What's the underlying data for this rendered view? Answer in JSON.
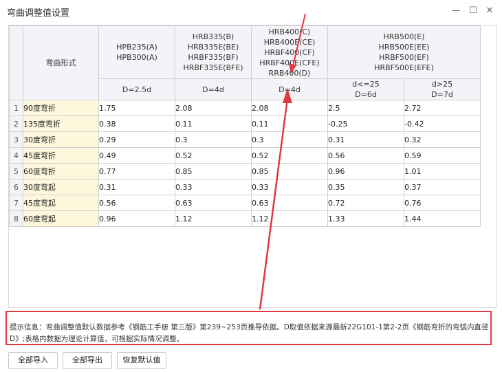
{
  "window": {
    "title": "弯曲调整值设置",
    "minimize_glyph": "—",
    "maximize_glyph": "☐",
    "close_glyph": "✕"
  },
  "table": {
    "label_header": "弯曲形式",
    "groups": [
      {
        "lines": [
          "HPB235(A)",
          "HPB300(A)"
        ]
      },
      {
        "lines": [
          "HRB335(B)",
          "HRB335E(BE)",
          "HRBF335(BF)",
          "HRBF335E(BFE)"
        ]
      },
      {
        "lines": [
          "HRB400(C)",
          "HRB400E(CE)",
          "HRBF400(CF)",
          "HRBF400E(CFE)",
          "RRB400(D)"
        ]
      },
      {
        "lines": [
          "HRB500(E)",
          "HRB500E(EE)",
          "HRBF500(EF)",
          "HRBF500E(EFE)"
        ]
      }
    ],
    "subheaders": [
      {
        "lines": [
          "D=2.5d"
        ]
      },
      {
        "lines": [
          "D=4d"
        ]
      },
      {
        "lines": [
          "D=4d"
        ]
      },
      {
        "lines": [
          "d<=25",
          "D=6d"
        ]
      },
      {
        "lines": [
          "d>25",
          "D=7d"
        ]
      }
    ],
    "rows": [
      {
        "num": "1",
        "label": "90度弯折",
        "values": [
          "1.75",
          "2.08",
          "2.08",
          "2.5",
          "2.72"
        ]
      },
      {
        "num": "2",
        "label": "135度弯折",
        "values": [
          "0.38",
          "0.11",
          "0.11",
          "-0.25",
          "-0.42"
        ]
      },
      {
        "num": "3",
        "label": "30度弯折",
        "values": [
          "0.29",
          "0.3",
          "0.3",
          "0.31",
          "0.32"
        ]
      },
      {
        "num": "4",
        "label": "45度弯折",
        "values": [
          "0.49",
          "0.52",
          "0.52",
          "0.56",
          "0.59"
        ]
      },
      {
        "num": "5",
        "label": "60度弯折",
        "values": [
          "0.77",
          "0.85",
          "0.85",
          "0.96",
          "1.01"
        ]
      },
      {
        "num": "6",
        "label": "30度弯起",
        "values": [
          "0.31",
          "0.33",
          "0.33",
          "0.35",
          "0.37"
        ]
      },
      {
        "num": "7",
        "label": "45度弯起",
        "values": [
          "0.56",
          "0.63",
          "0.63",
          "0.72",
          "0.76"
        ]
      },
      {
        "num": "8",
        "label": "60度弯起",
        "values": [
          "0.96",
          "1.12",
          "1.12",
          "1.33",
          "1.44"
        ]
      }
    ]
  },
  "tip": {
    "text": "提示信息：弯曲调整值默认数据参考《钢筋工手册 第三版》第239~253页推导依据。D取值依据来源最新22G101-1第2-2页《钢筋弯折的弯弧内直径D》;表格内数据为理论计算值，可根据实际情况调整。"
  },
  "buttons": {
    "import_all": "全部导入",
    "export_all": "全部导出",
    "restore_default": "恢复默认值"
  },
  "colors": {
    "annotation_red": "#e0393e",
    "label_cell_bg": "#fdf7dc",
    "header_bg": "#f3f4f7"
  }
}
